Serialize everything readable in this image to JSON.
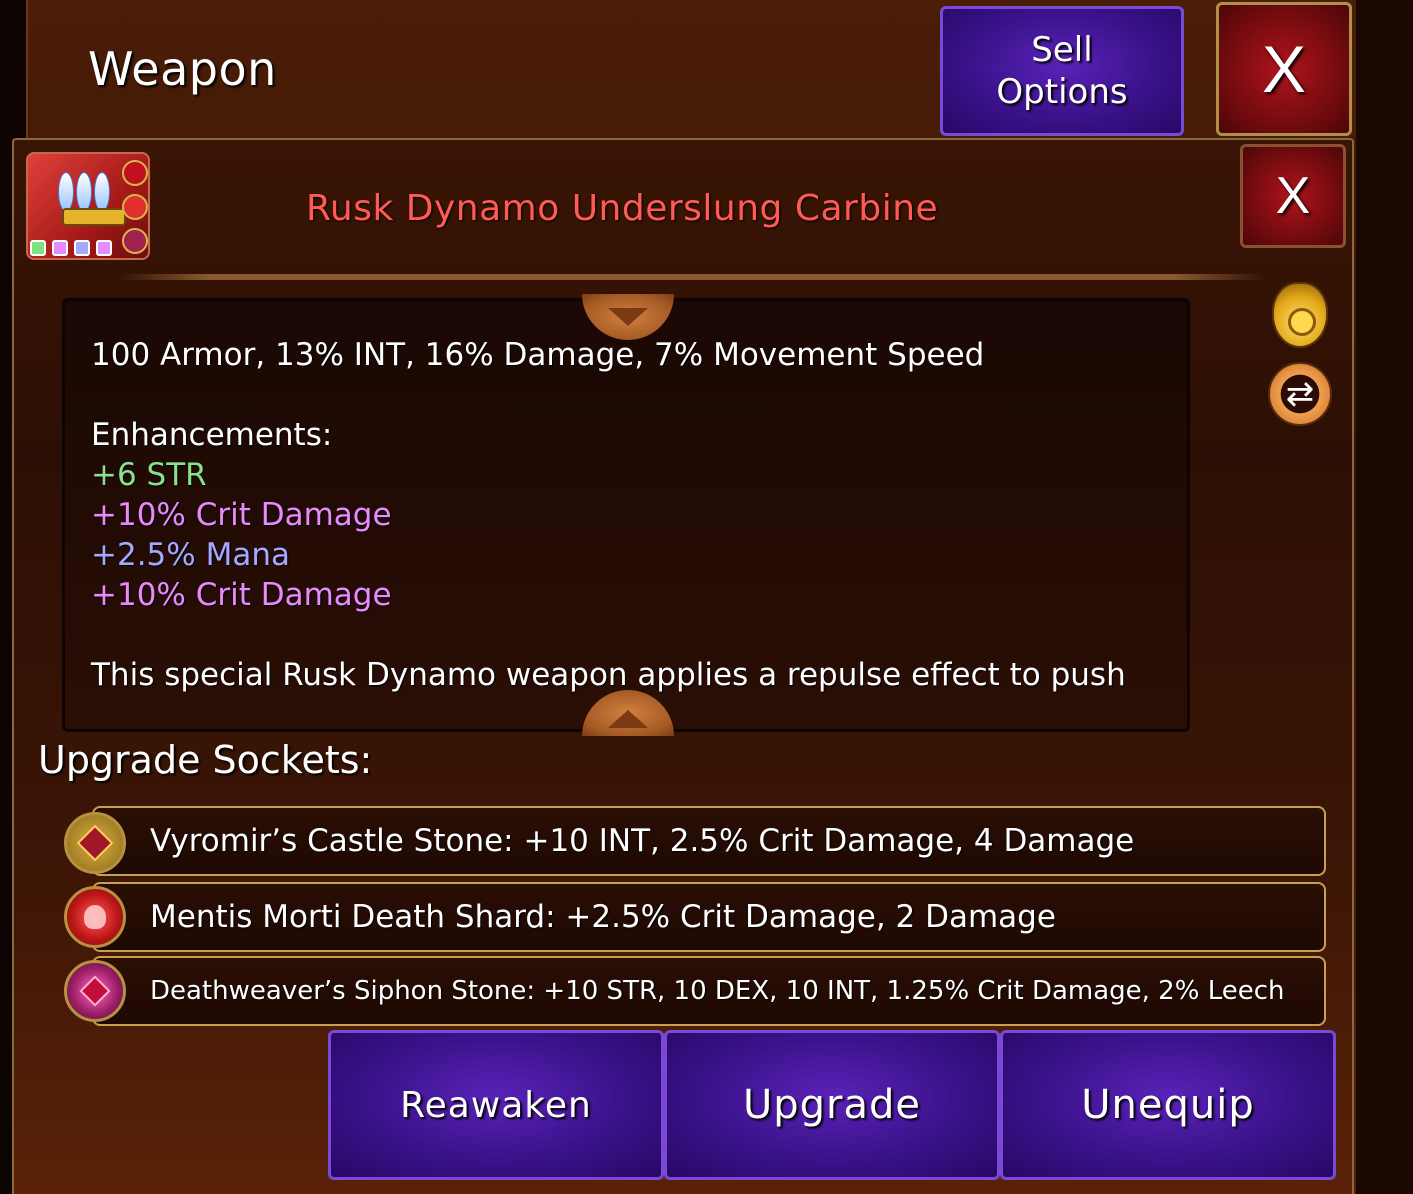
{
  "window": {
    "title": "Weapon",
    "sell_button": "Sell\nOptions",
    "close_label": "X"
  },
  "item": {
    "name": "Rusk Dynamo Underslung Carbine",
    "close_label": "X",
    "icon": "carbine-weapon-icon",
    "gem_colors": [
      "#7fe07f",
      "#e88aff",
      "#a4a8ff",
      "#e88aff"
    ]
  },
  "description": {
    "stats_line": "100 Armor, 13% INT, 16% Damage, 7% Movement Speed",
    "enhancements_label": "Enhancements:",
    "enhancements": [
      {
        "text": "+6 STR",
        "color": "#8ce08c"
      },
      {
        "text": "+10% Crit Damage",
        "color": "#e88aff"
      },
      {
        "text": "+2.5% Mana",
        "color": "#a4a8ff"
      },
      {
        "text": "+10% Crit Damage",
        "color": "#e88aff"
      }
    ],
    "special": "This special Rusk Dynamo weapon applies a repulse effect to push"
  },
  "side_icons": {
    "sell": "money-bag-icon",
    "swap": "swap-icon"
  },
  "sockets": {
    "title": "Upgrade Sockets:",
    "items": [
      {
        "text": "Vyromir’s Castle Stone: +10 INT, 2.5% Crit Damage, 4 Damage",
        "icon": "castle-stone-icon"
      },
      {
        "text": "Mentis Morti Death Shard: +2.5% Crit Damage, 2 Damage",
        "icon": "skull-shard-icon"
      },
      {
        "text": "Deathweaver’s Siphon Stone: +10 STR, 10 DEX, 10 INT, 1.25% Crit Damage, 2% Leech",
        "icon": "siphon-stone-icon"
      }
    ]
  },
  "actions": {
    "reawaken": "Reawaken",
    "upgrade": "Upgrade",
    "unequip": "Unequip"
  }
}
